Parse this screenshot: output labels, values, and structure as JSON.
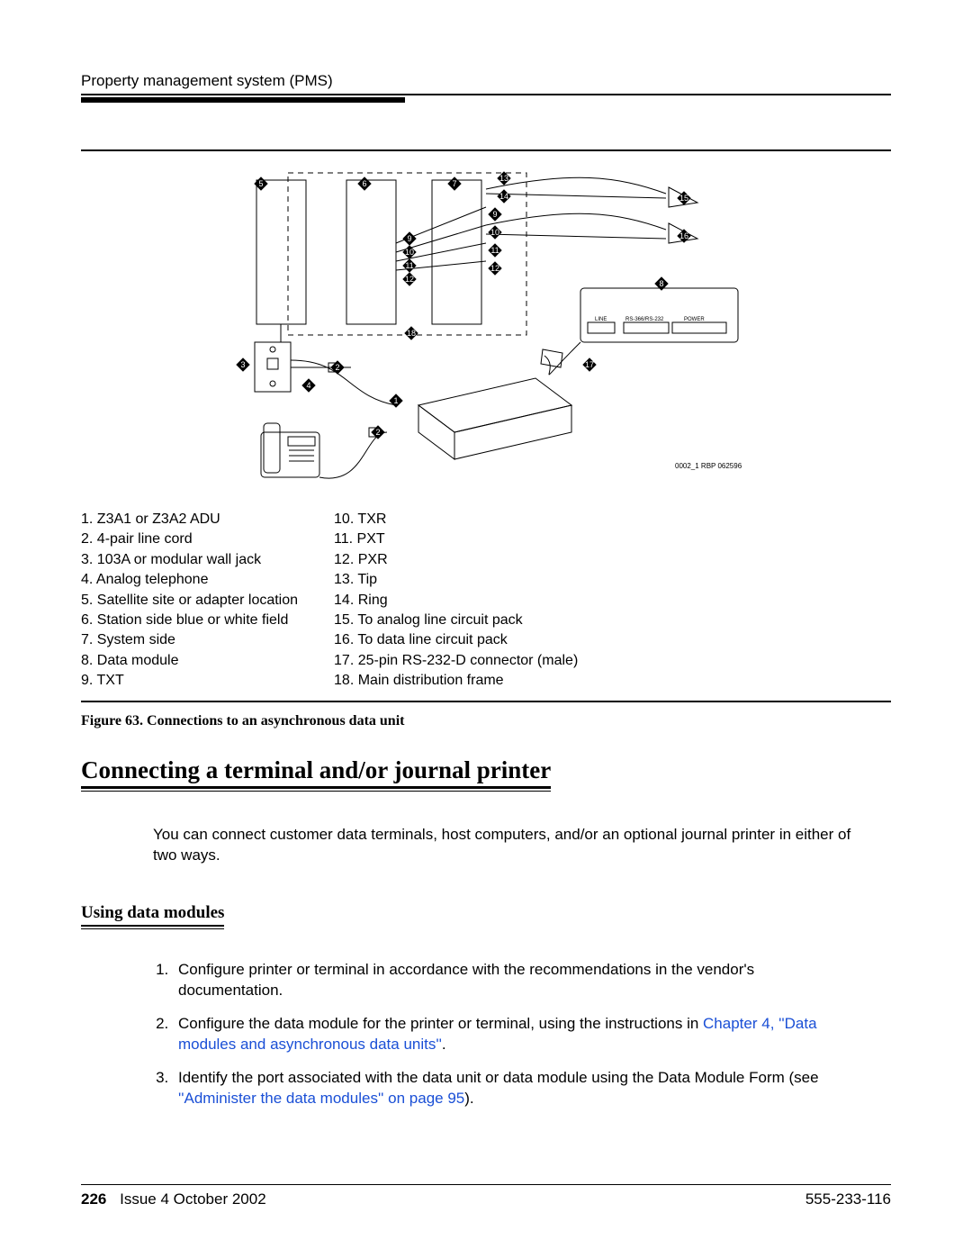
{
  "header": {
    "title": "Property management system (PMS)"
  },
  "figure": {
    "drawing_code": "0002_1 RBP 062596",
    "caption": "Figure 63.    Connections to an asynchronous data unit",
    "legend_left": [
      "1. Z3A1 or Z3A2 ADU",
      "2. 4-pair line cord",
      "3. 103A or modular wall jack",
      "4. Analog telephone",
      "5. Satellite site or adapter location",
      "6. Station side blue or white field",
      "7. System side",
      "8. Data module",
      "9. TXT"
    ],
    "legend_right": [
      "10. TXR",
      "11. PXT",
      "12. PXR",
      "13. Tip",
      "14. Ring",
      "15. To analog line circuit pack",
      "16. To data line circuit pack",
      "17. 25-pin RS-232-D connector (male)",
      "18. Main distribution frame"
    ]
  },
  "sections": {
    "h2": "Connecting a terminal and/or journal printer",
    "intro": "You can connect customer data terminals, host computers, and/or an optional journal printer in either of two ways.",
    "h3": "Using data modules",
    "step1": "Configure printer or terminal in accordance with the recommendations in the vendor's documentation.",
    "step2a": "Configure the data module for the printer or terminal, using the instructions in ",
    "step2_link": "Chapter 4, ''Data modules and asynchronous data units''",
    "step2b": ".",
    "step3a": "Identify the port associated with the data unit or data module using the Data Module Form (see ",
    "step3_link": "''Administer the data modules'' on page 95",
    "step3b": ")."
  },
  "footer": {
    "page": "226",
    "issue": "Issue 4   October 2002",
    "docnum": "555-233-116"
  }
}
